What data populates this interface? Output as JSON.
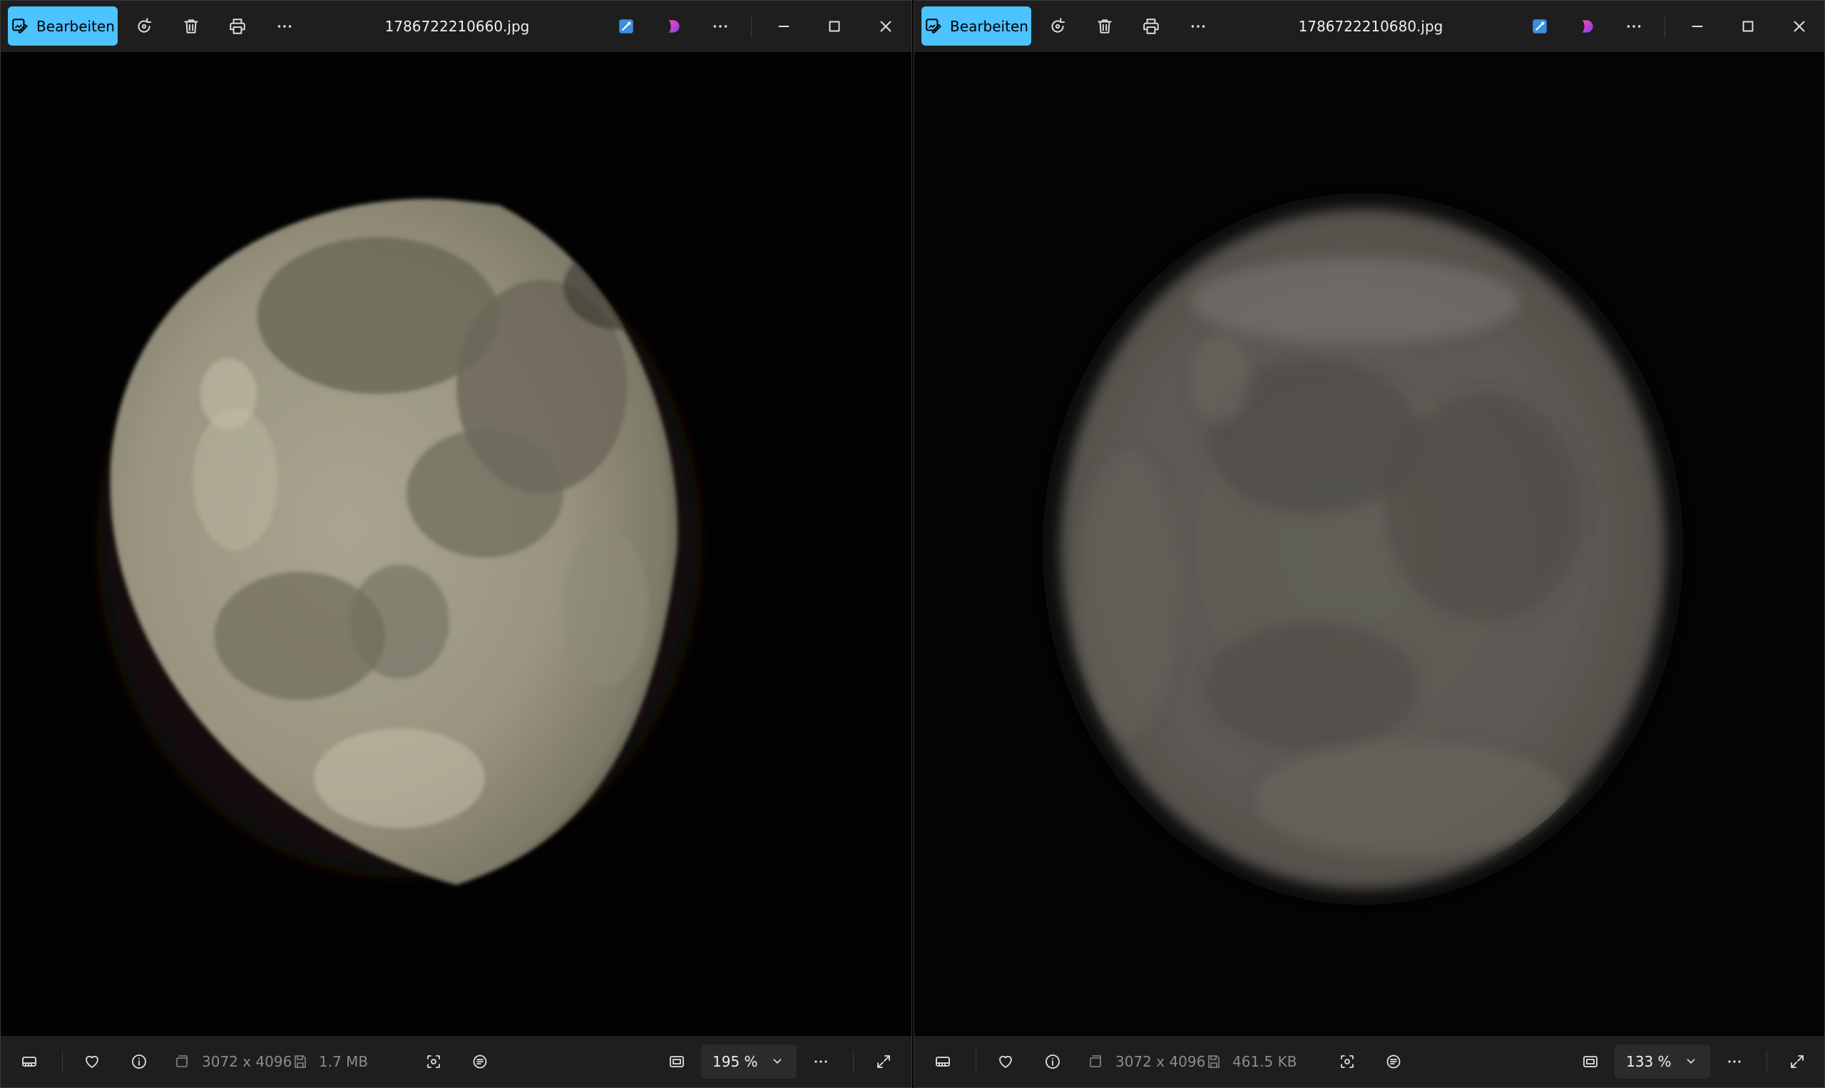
{
  "windows": [
    {
      "edit_label": "Bearbeiten",
      "filename": "1786722210660.jpg",
      "dimensions": "3072 x 4096",
      "filesize": "1.7 MB",
      "zoom": "195 %"
    },
    {
      "edit_label": "Bearbeiten",
      "filename": "1786722210680.jpg",
      "dimensions": "3072 x 4096",
      "filesize": "461.5 KB",
      "zoom": "133 %"
    }
  ],
  "colors": {
    "accent": "#4cc2ff",
    "bar_bg": "#1e1e1e",
    "zoom_bg": "#2b2b2b",
    "muted_text": "#8c8c8c"
  }
}
